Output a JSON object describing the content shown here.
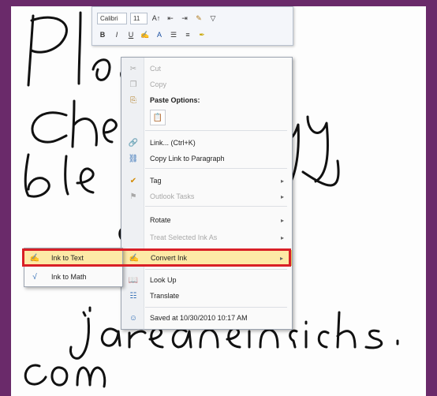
{
  "mini_toolbar": {
    "font_name": "Calibri",
    "font_size": "11",
    "row1_icons": [
      "grow-font-icon",
      "decrease-indent-icon",
      "increase-indent-icon",
      "format-painter-icon",
      "tag-icon"
    ],
    "row2": {
      "bold": "B",
      "italic": "I",
      "underline": "U"
    }
  },
  "context_menu": {
    "items": [
      {
        "label": "Cut",
        "shortcut": "",
        "disabled": true,
        "icon": "scissors-icon"
      },
      {
        "label": "Copy",
        "shortcut": "",
        "disabled": true,
        "icon": "copy-icon"
      },
      {
        "label": "Paste Options:",
        "shortcut": "",
        "disabled": false,
        "icon": "clipboard-icon"
      },
      {
        "label": "Link...  (Ctrl+K)",
        "shortcut": "",
        "disabled": false,
        "icon": "link-icon"
      },
      {
        "label": "Copy Link to Paragraph",
        "shortcut": "",
        "disabled": false,
        "icon": "copy-link-icon"
      },
      {
        "label": "Tag",
        "shortcut": "",
        "disabled": false,
        "icon": "tag-icon"
      },
      {
        "label": "Outlook Tasks",
        "shortcut": "",
        "disabled": true,
        "icon": "flag-icon"
      },
      {
        "label": "Rotate",
        "shortcut": "",
        "disabled": false,
        "icon": ""
      },
      {
        "label": "Treat Selected Ink As",
        "shortcut": "",
        "disabled": true,
        "icon": ""
      },
      {
        "label": "Convert Ink",
        "shortcut": "",
        "disabled": false,
        "icon": "convert-ink-icon"
      },
      {
        "label": "Look Up",
        "shortcut": "",
        "disabled": false,
        "icon": "research-icon"
      },
      {
        "label": "Translate",
        "shortcut": "",
        "disabled": false,
        "icon": "translate-icon"
      },
      {
        "label": "Saved at 10/30/2010 10:17 AM",
        "shortcut": "",
        "disabled": false,
        "icon": "person-icon"
      }
    ]
  },
  "submenu": {
    "items": [
      {
        "label": "Ink to Text",
        "icon": "ink-to-text-icon"
      },
      {
        "label": "Ink to Math",
        "icon": "ink-to-math-icon"
      }
    ]
  },
  "colors": {
    "frame": "#6a2a6a",
    "highlight": "#fde9a6",
    "callout": "#d91f26"
  }
}
